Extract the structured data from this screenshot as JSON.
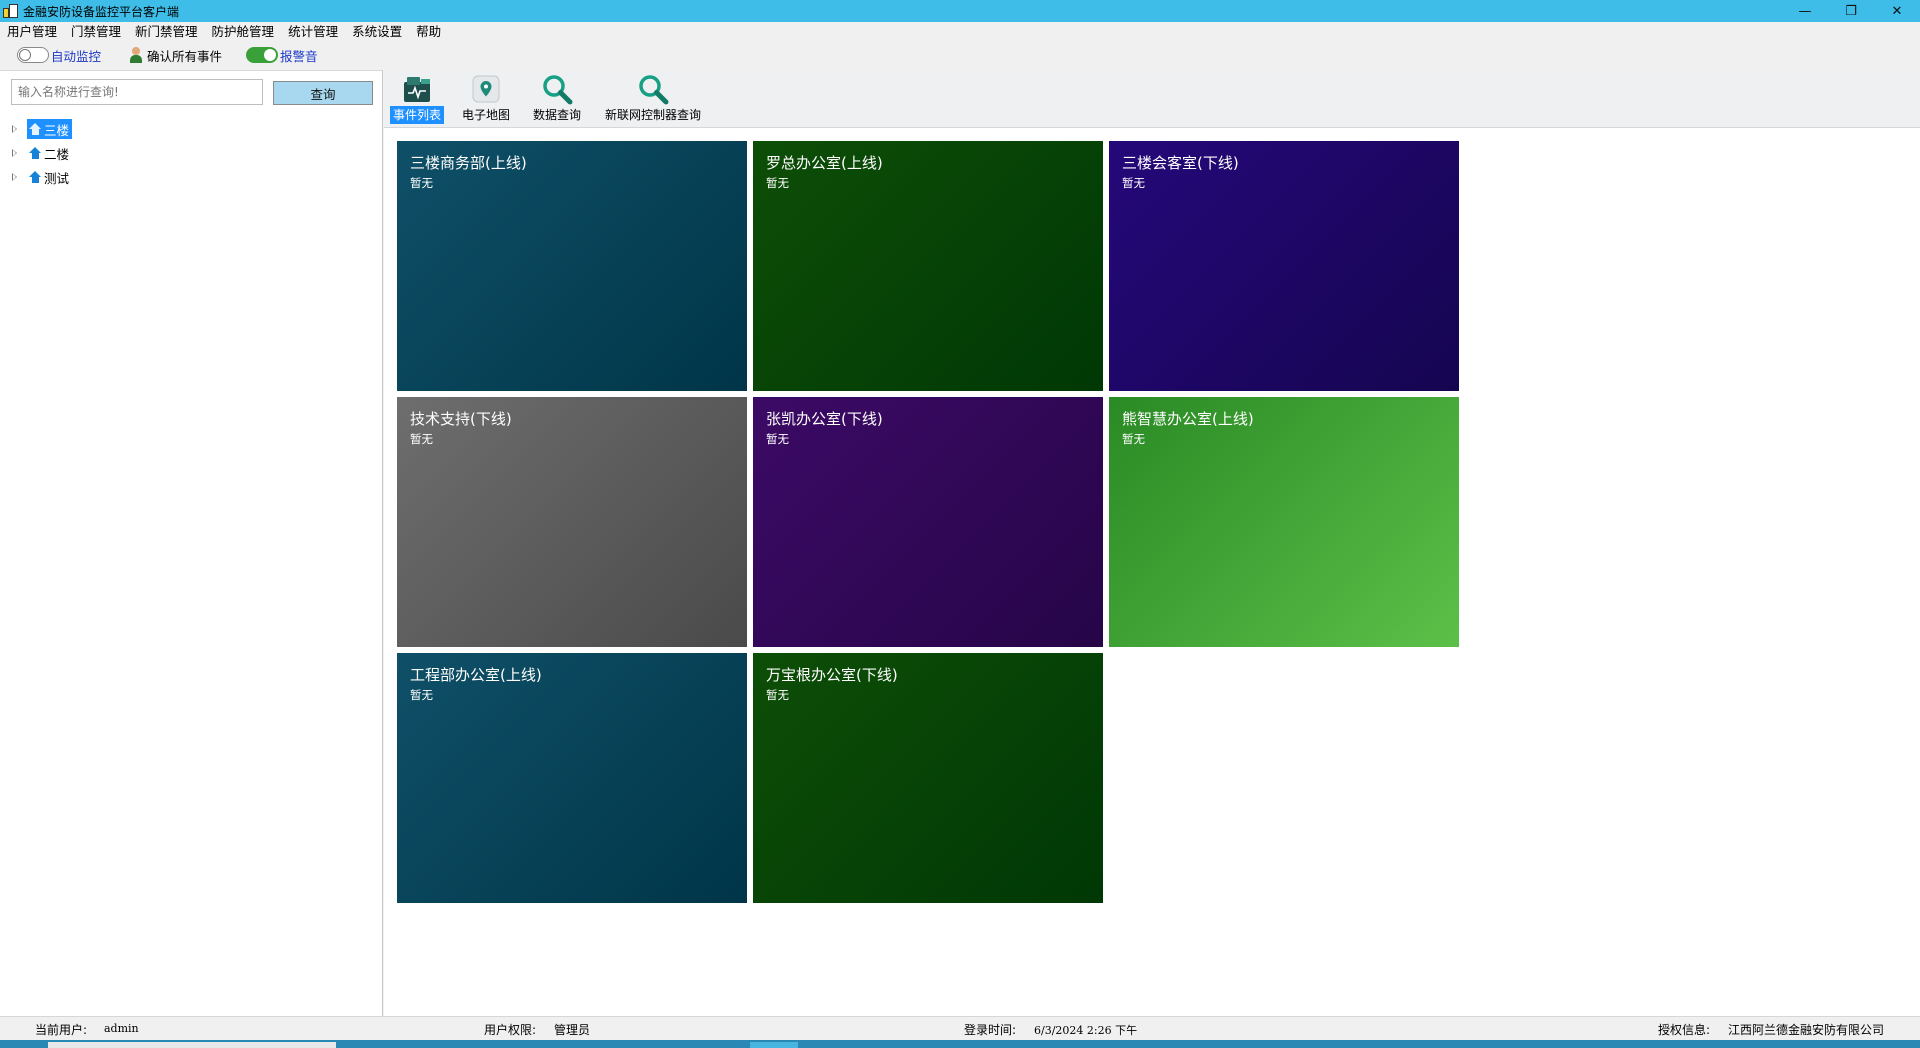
{
  "window": {
    "title": "金融安防设备监控平台客户端",
    "controls": {
      "minimize": "—",
      "restore": "❐",
      "close": "✕"
    }
  },
  "menu": [
    "用户管理",
    "门禁管理",
    "新门禁管理",
    "防护舱管理",
    "统计管理",
    "系统设置",
    "帮助"
  ],
  "toolbar": {
    "auto_monitor": {
      "label": "自动监控",
      "on": false
    },
    "confirm_all": {
      "label": "确认所有事件"
    },
    "alarm_sound": {
      "label": "报警音",
      "on": true
    },
    "switch_on_color": "#3aa13a"
  },
  "search": {
    "placeholder": "输入名称进行查询!",
    "button": "查询"
  },
  "tree": [
    {
      "label": "三楼",
      "selected": true
    },
    {
      "label": "二楼",
      "selected": false
    },
    {
      "label": "测试",
      "selected": false
    }
  ],
  "nav": [
    {
      "label": "事件列表",
      "icon": "event-list-icon",
      "active": true
    },
    {
      "label": "电子地图",
      "icon": "map-pin-icon",
      "active": false
    },
    {
      "label": "数据查询",
      "icon": "magnifier-icon",
      "active": false
    },
    {
      "label": "新联网控制器查询",
      "icon": "magnifier-icon",
      "active": false
    }
  ],
  "cards": [
    {
      "title": "三楼商务部(上线)",
      "sub": "暂无",
      "from": "#0f5068",
      "to": "#003548"
    },
    {
      "title": "罗总办公室(上线)",
      "sub": "暂无",
      "from": "#0d4e07",
      "to": "#003805"
    },
    {
      "title": "三楼会客室(下线)",
      "sub": "暂无",
      "from": "#25087a",
      "to": "#150550"
    },
    {
      "title": "技术支持(下线)",
      "sub": "暂无",
      "from": "#6e6e6e",
      "to": "#4a4a4a"
    },
    {
      "title": "张凯办公室(下线)",
      "sub": "暂无",
      "from": "#3c0a66",
      "to": "#260548"
    },
    {
      "title": "熊智慧办公室(上线)",
      "sub": "暂无",
      "from": "#2a8a25",
      "to": "#5cc048"
    },
    {
      "title": "工程部办公室(上线)",
      "sub": "暂无",
      "from": "#0f5068",
      "to": "#003548"
    },
    {
      "title": "万宝根办公室(下线)",
      "sub": "暂无",
      "from": "#0d4e07",
      "to": "#003805"
    }
  ],
  "status": {
    "user_label": "当前用户:",
    "user": "admin",
    "perm_label": "用户权限:",
    "perm": "管理员",
    "login_label": "登录时间:",
    "login_time": "6/3/2024 2:26 下午",
    "license_label": "授权信息:",
    "license": "江西阿兰德金融安防有限公司"
  }
}
